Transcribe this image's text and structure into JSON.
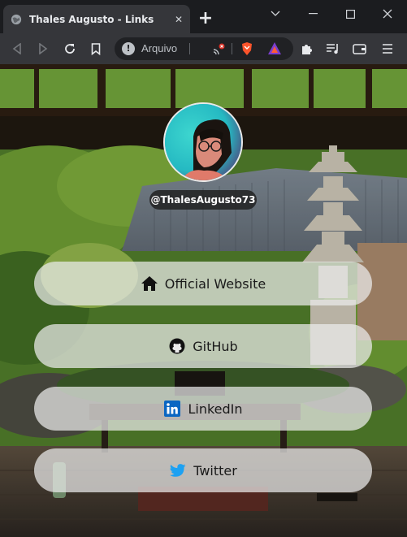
{
  "browser": {
    "tab_title": "Thales Augusto - Links",
    "tab_close": "✕",
    "new_tab": "+",
    "omnibox_security_label": "Arquivo"
  },
  "profile": {
    "handle": "@ThalesAugusto73"
  },
  "links": [
    {
      "label": "Official Website",
      "icon": "home-icon"
    },
    {
      "label": "GitHub",
      "icon": "github-icon"
    },
    {
      "label": "LinkedIn",
      "icon": "linkedin-icon"
    },
    {
      "label": "Twitter",
      "icon": "twitter-icon"
    }
  ],
  "colors": {
    "linkedin": "#0a66c2",
    "twitter": "#1da1f2",
    "brave": "#fb542b"
  }
}
